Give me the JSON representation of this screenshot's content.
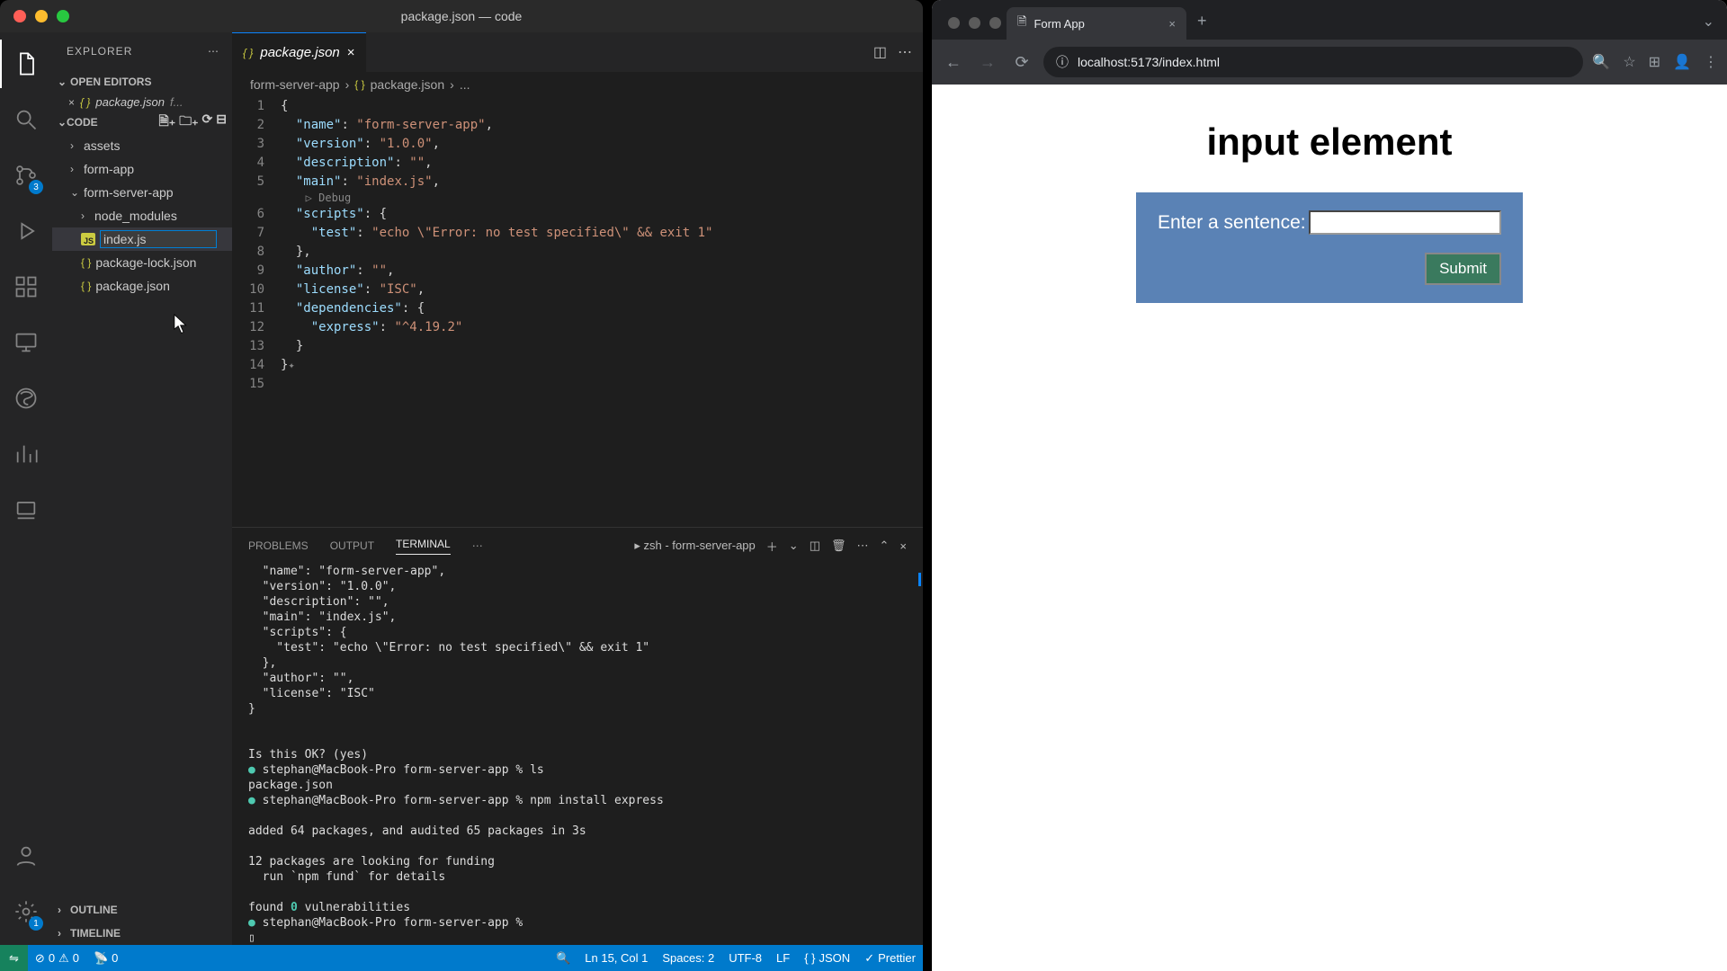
{
  "vscode": {
    "title": "package.json — code",
    "explorer_label": "EXPLORER",
    "open_editors_label": "OPEN EDITORS",
    "open_editor_file": "package.json",
    "open_editor_suffix": "f...",
    "code_section": "CODE",
    "tree": {
      "assets": "assets",
      "form_app": "form-app",
      "form_server_app": "form-server-app",
      "node_modules": "node_modules",
      "new_file_value": "index.js",
      "package_lock": "package-lock.json",
      "package_json": "package.json"
    },
    "outline": "OUTLINE",
    "timeline": "TIMELINE",
    "tab_name": "package.json",
    "breadcrumb_root": "form-server-app",
    "breadcrumb_file": "package.json",
    "breadcrumb_rest": "...",
    "debug_label": "Debug",
    "code_lines": {
      "l1": "{",
      "l2_k": "\"name\"",
      "l2_v": "\"form-server-app\"",
      "l3_k": "\"version\"",
      "l3_v": "\"1.0.0\"",
      "l4_k": "\"description\"",
      "l4_v": "\"\"",
      "l5_k": "\"main\"",
      "l5_v": "\"index.js\"",
      "l7_k": "\"scripts\"",
      "l8_k": "\"test\"",
      "l8_v": "\"echo \\\"Error: no test specified\\\" && exit 1\"",
      "l10_k": "\"author\"",
      "l10_v": "\"\"",
      "l11_k": "\"license\"",
      "l11_v": "\"ISC\"",
      "l12_k": "\"dependencies\"",
      "l13_k": "\"express\"",
      "l13_v": "\"^4.19.2\""
    },
    "panel": {
      "problems": "PROBLEMS",
      "output": "OUTPUT",
      "terminal": "TERMINAL",
      "shell": "zsh - form-server-app"
    },
    "terminal_lines": [
      "  \"name\": \"form-server-app\",",
      "  \"version\": \"1.0.0\",",
      "  \"description\": \"\",",
      "  \"main\": \"index.js\",",
      "  \"scripts\": {",
      "    \"test\": \"echo \\\"Error: no test specified\\\" && exit 1\"",
      "  },",
      "  \"author\": \"\",",
      "  \"license\": \"ISC\"",
      "}",
      "",
      "",
      "Is this OK? (yes)",
      "stephan@MacBook-Pro form-server-app % ls",
      "package.json",
      "stephan@MacBook-Pro form-server-app % npm install express",
      "",
      "added 64 packages, and audited 65 packages in 3s",
      "",
      "12 packages are looking for funding",
      "  run `npm fund` for details",
      "",
      "found 0 vulnerabilities",
      "stephan@MacBook-Pro form-server-app % "
    ],
    "status": {
      "errors": "0",
      "warnings": "0",
      "ports": "0",
      "cursor": "Ln 15, Col 1",
      "spaces": "Spaces: 2",
      "encoding": "UTF-8",
      "eol": "LF",
      "lang": "JSON",
      "prettier": "Prettier"
    },
    "scm_badge": "3",
    "gear_badge": "1"
  },
  "browser": {
    "tab_title": "Form App",
    "url": "localhost:5173/index.html",
    "heading": "input element",
    "label": "Enter a sentence:",
    "submit": "Submit"
  }
}
